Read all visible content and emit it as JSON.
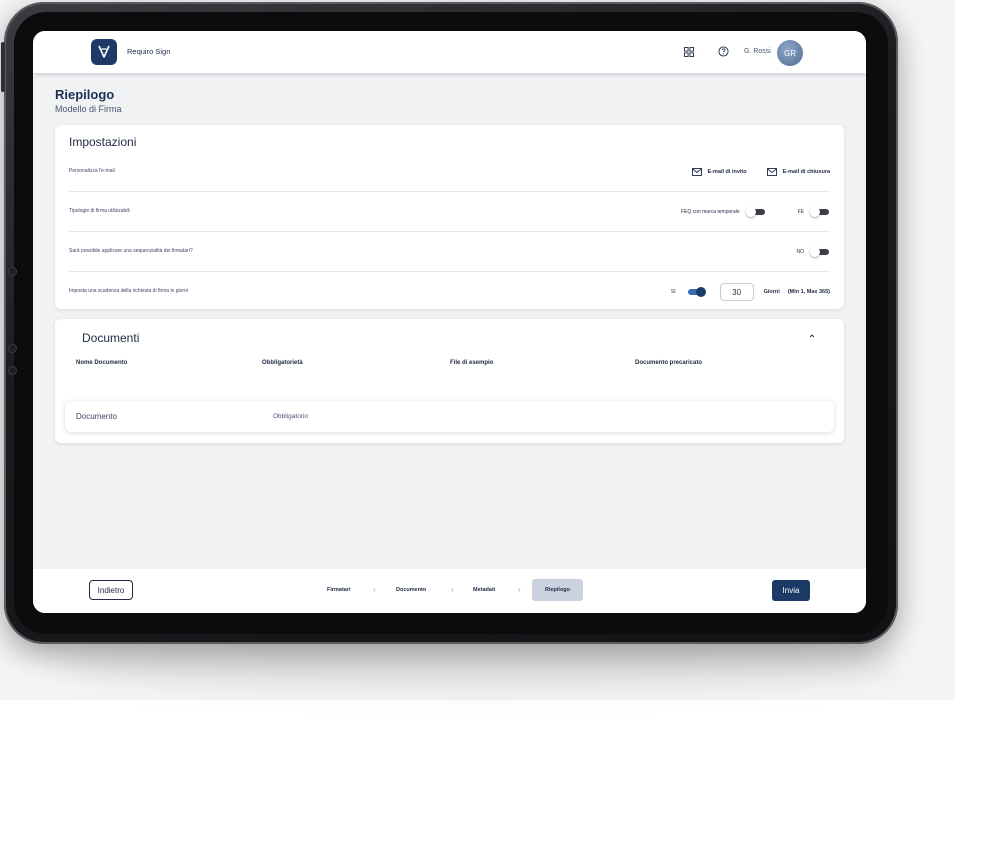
{
  "header": {
    "app_title": "Requiro Sign",
    "user_name": "G. Rossi",
    "avatar_initials": "GR"
  },
  "page": {
    "title": "Riepilogo",
    "subtitle": "Modello di Firma"
  },
  "settings": {
    "title": "Impostazioni",
    "rows": [
      {
        "label": "Personalizza l'e-mail",
        "links": [
          "E-mail di invito",
          "E-mail di chiusura"
        ]
      },
      {
        "label": "Tipologie di firma utilizzabili",
        "options": [
          {
            "label": "FEQ con marca temporale",
            "enabled": false
          },
          {
            "label": "FE",
            "enabled": false
          }
        ]
      },
      {
        "label": "Sarà possibile applicare una sequenzialità dei firmatari?",
        "options": [
          {
            "label": "NO",
            "enabled": false
          }
        ]
      },
      {
        "label": "Imposta una scadenza della richiesta di firma in giorni",
        "toggle_label": "SI",
        "toggle_enabled": true,
        "days_value": "30",
        "days_unit": "Giorni",
        "days_range": "(Min 1, Max 365)"
      }
    ]
  },
  "documents": {
    "title": "Documenti",
    "columns": [
      "Nome Documento",
      "Obbligatorietà",
      "File di esempio",
      "Documento precaricato"
    ],
    "rows": [
      {
        "name": "Documento",
        "requirement": "Obbligatorio",
        "example_file": "",
        "preloaded": ""
      }
    ]
  },
  "footer": {
    "back_label": "Indietro",
    "steps": [
      "Firmatari",
      "Documento",
      "Metadati",
      "Riepilogo"
    ],
    "active_step": "Riepilogo",
    "send_label": "Invia"
  },
  "colors": {
    "primary": "#1c3a66",
    "toggle_on": "#3b6db5",
    "toggle_off": "#3b3f46",
    "background": "#f1f2f3",
    "active_step_bg": "#c9d2de"
  }
}
